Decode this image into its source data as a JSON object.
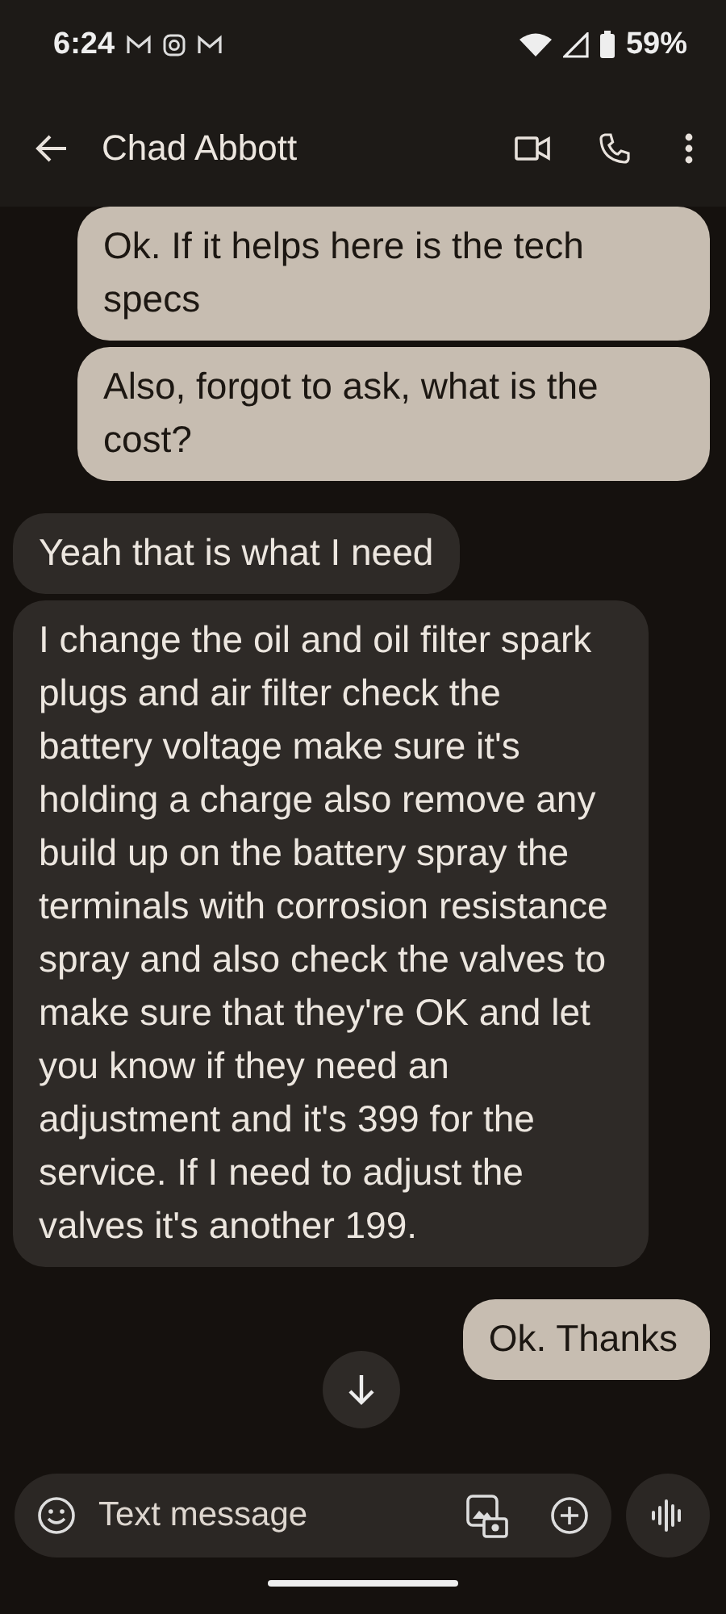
{
  "status_bar": {
    "time": "6:24",
    "battery": "59%"
  },
  "header": {
    "contact": "Chad Abbott"
  },
  "messages": [
    {
      "kind": "outgoing",
      "text": "Ok. If it helps here is the tech specs"
    },
    {
      "kind": "outgoing",
      "text": "Also, forgot to ask, what is the cost?"
    },
    {
      "kind": "incoming",
      "text": "Yeah that is what I need"
    },
    {
      "kind": "incoming",
      "text": "I change the oil and oil filter spark plugs and air filter check the battery voltage make sure it's holding a charge also remove any build up on the battery spray the terminals with corrosion resistance spray and also check the valves to make sure that they're OK and let you know if they need an adjustment and it's 399 for the service. If I need to adjust the valves it's another 199."
    },
    {
      "kind": "outgoing",
      "text": "Ok. Thanks"
    }
  ],
  "composer": {
    "placeholder": "Text message"
  }
}
